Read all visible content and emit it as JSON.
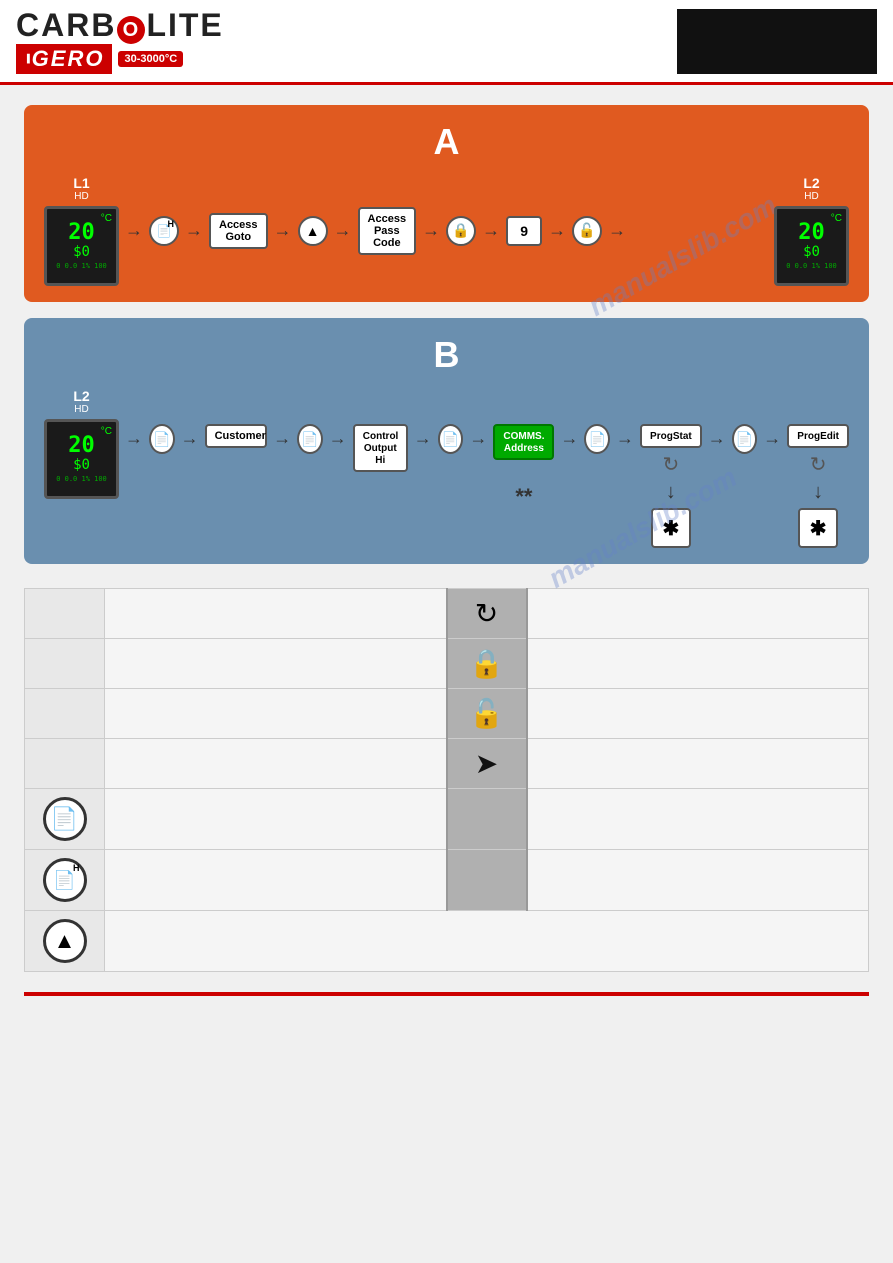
{
  "header": {
    "logo_carbolite": "CARB",
    "logo_o": "O",
    "logo_lite": "LITE",
    "logo_gero": "IGERO",
    "temp_range": "30-3000°C",
    "title": "Carbolite Gero"
  },
  "section_a": {
    "label": "A",
    "zone_l1": {
      "title": "L1",
      "subtitle": "HD",
      "temp": "20",
      "power": "$0",
      "bottom": "0 0.0  1%\n100"
    },
    "zone_l2": {
      "title": "L2",
      "subtitle": "HD",
      "temp": "20",
      "power": "$0",
      "bottom": "0 0.0  1%\n100"
    },
    "flow": {
      "access_goto": "Access\nGoto",
      "access_passcode": "Access\nPass\nCode",
      "number": "9"
    }
  },
  "section_b": {
    "label": "B",
    "zone_l2": {
      "title": "L2",
      "subtitle": "HD",
      "temp": "20",
      "power": "$0",
      "bottom": "0 0.0  1%\n100"
    },
    "flow": {
      "customer": "Customer",
      "control_output_hi": "Control\nOutput\nHi",
      "comms_address": "COMMS.\nAddress",
      "prog_stat": "ProgStat",
      "prog_edit": "ProgEdit",
      "double_asterisk": "**"
    }
  },
  "legend": {
    "rows": [
      {
        "icon_type": "refresh",
        "divider_icon": "refresh",
        "description": ""
      },
      {
        "icon_type": "lock-closed",
        "divider_icon": "lock-closed",
        "description": ""
      },
      {
        "icon_type": "lock-open",
        "divider_icon": "lock-open",
        "description": ""
      },
      {
        "icon_type": "arrow-right",
        "divider_icon": "arrow-right",
        "description": ""
      },
      {
        "icon_type": "file",
        "divider_icon": "",
        "description": ""
      },
      {
        "icon_type": "file-h",
        "divider_icon": "",
        "description": ""
      },
      {
        "icon_type": "up-arrow",
        "divider_icon": "",
        "description": ""
      }
    ]
  }
}
